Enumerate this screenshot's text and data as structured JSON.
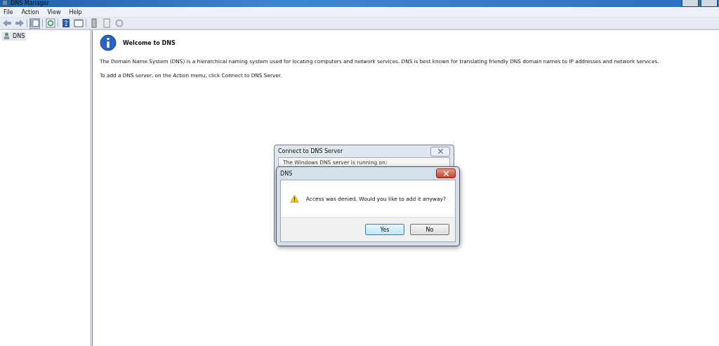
{
  "window": {
    "title": "DNS Manager"
  },
  "menu": [
    "File",
    "Action",
    "View",
    "Help"
  ],
  "tree": [
    {
      "label": "DNS",
      "selected": true
    }
  ],
  "welcome": {
    "title": "Welcome to DNS",
    "paragraphs": [
      "The Domain Name System (DNS) is a hierarchical naming system used for locating computers and network services. DNS is best known for translating friendly DNS domain names to IP addresses and network services.",
      "To add a DNS server, on the Action menu, click Connect to DNS Server."
    ]
  },
  "connect_dialog": {
    "title": "Connect to DNS Server",
    "group_text": "The Windows DNS server is running on:"
  },
  "alert_dialog": {
    "title": "DNS",
    "message": "Access was denied. Would you like to add it anyway?",
    "buttons": [
      {
        "label": "Yes",
        "default": true
      },
      {
        "label": "No",
        "default": false
      }
    ]
  }
}
